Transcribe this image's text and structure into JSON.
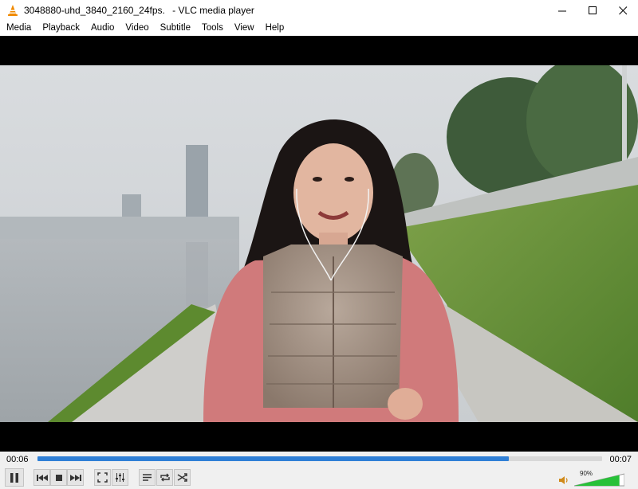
{
  "window": {
    "filename": "3048880-uhd_3840_2160_24fps.",
    "separator": " - ",
    "app_name": "VLC media player"
  },
  "menu": [
    "Media",
    "Playback",
    "Audio",
    "Video",
    "Subtitle",
    "Tools",
    "View",
    "Help"
  ],
  "playback": {
    "elapsed": "00:06",
    "total": "00:07",
    "progress": 0.835
  },
  "volume": {
    "label": "90%",
    "level": 0.9
  },
  "colors": {
    "accent": "#2f7fd6",
    "volume_green": "#27c138"
  }
}
